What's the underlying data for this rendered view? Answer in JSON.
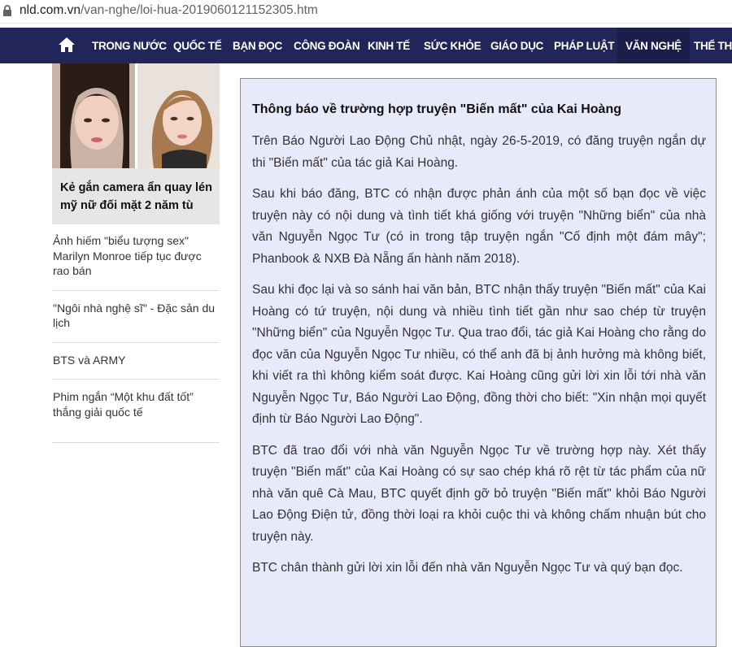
{
  "browser": {
    "url_host": "nld.com.vn",
    "url_path": "/van-nghe/loi-hua-2019060121152305.htm"
  },
  "nav": {
    "home_icon": "home-icon",
    "items": [
      "TRONG NƯỚC",
      "QUỐC TẾ",
      "BẠN ĐỌC",
      "CÔNG ĐOÀN",
      "KINH TẾ",
      "SỨC KHỎE",
      "GIÁO DỤC",
      "PHÁP LUẬT",
      "VĂN NGHỆ",
      "THỂ THA"
    ],
    "active": "VĂN NGHỆ",
    "bg_color": "#22255a"
  },
  "sidebar": {
    "featured_title": "Kẻ gắn camera ẩn quay lén mỹ nữ đối mặt 2 năm tù",
    "items": [
      "Ảnh hiếm \"biểu tượng sex\" Marilyn Monroe tiếp tục được rao bán",
      "\"Ngôi nhà nghệ sĩ\" - Đặc sản du lịch",
      "BTS và ARMY",
      "Phim ngắn “Một khu đất tốt” thắng giải quốc tế"
    ]
  },
  "article": {
    "title": "Thông báo về trường hợp truyện \"Biến mất\" của Kai Hoàng",
    "paragraphs": [
      "Trên Báo Người Lao Động Chủ nhật, ngày 26-5-2019, có đăng truyện ngắn dự thi \"Biến mất\" của tác giả Kai Hoàng.",
      "Sau khi báo đăng, BTC có nhận được phản ánh của một số bạn đọc về việc truyện này có nội dung và tình tiết khá giống với truyện \"Những biển\" của nhà văn Nguyễn Ngọc Tư (có in trong tập truyện ngắn \"Cố định một đám mây\"; Phanbook & NXB Đà Nẵng ấn hành năm 2018).",
      "Sau khi đọc lại và so sánh hai văn bản, BTC nhận thấy truyện \"Biến mất\" của Kai Hoàng có tứ truyện, nội dung và nhiều tình tiết gần như sao chép từ truyện \"Những biển\" của Nguyễn Ngọc Tư. Qua trao đổi, tác giả Kai Hoàng cho rằng do đọc văn của Nguyễn Ngọc Tư nhiều, có thể anh đã bị ảnh hưởng mà không biết, khi viết ra thì không kiểm soát được. Kai Hoàng cũng gửi lời xin lỗi tới nhà văn Nguyễn Ngọc Tư, Báo Người Lao Động, đồng thời cho biết: \"Xin nhận mọi quyết định từ Báo Người Lao Động\".",
      "BTC đã trao đổi với nhà văn Nguyễn Ngọc Tư về trường hợp này. Xét thấy truyện \"Biến mất\" của Kai Hoàng có sự sao chép khá rõ rệt từ tác phẩm của nữ nhà văn quê Cà Mau, BTC quyết định gỡ bỏ truyện \"Biến mất\" khỏi Báo Người Lao Động Điện tử, đồng thời loại ra khỏi cuộc thi và không chấm nhuận bút cho truyện này.",
      "BTC chân thành gửi lời xin lỗi đến nhà văn Nguyễn Ngọc Tư và quý bạn đọc."
    ],
    "bg_color": "#e8e9fa"
  }
}
